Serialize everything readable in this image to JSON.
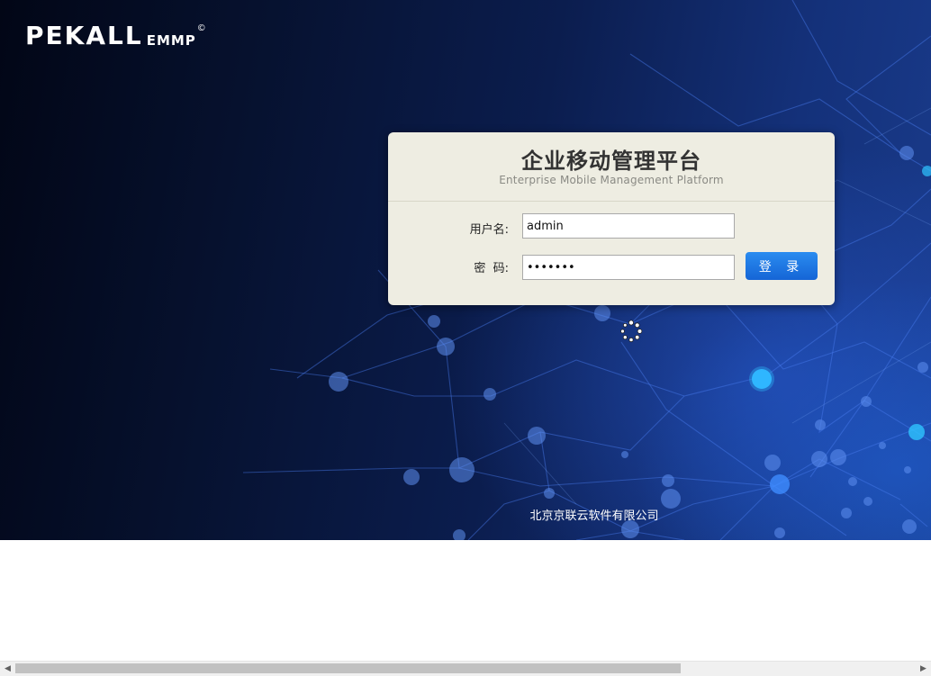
{
  "brand": {
    "logo_text": "PEKALL",
    "logo_sub": "EMMP",
    "logo_reg": "©"
  },
  "login": {
    "title": "企业移动管理平台",
    "subtitle": "Enterprise Mobile Management Platform",
    "username_label": "用户名:",
    "username_value": "admin",
    "password_label": "密  码:",
    "password_value": "1234567",
    "submit_label": "登 录"
  },
  "footer": {
    "company": "北京京联云软件有限公司"
  },
  "icons": {
    "loading": "loading-spinner-icon",
    "scroll_left": "chevron-left-icon",
    "scroll_right": "chevron-right-icon"
  },
  "colors": {
    "button": "#1f78e6",
    "panel": "#eeede2",
    "background_dark": "#06112e",
    "background_light": "#1a3c8d"
  }
}
